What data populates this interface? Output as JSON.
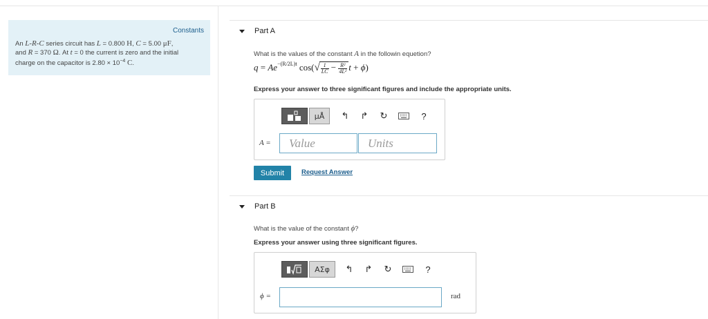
{
  "constants": {
    "title": "Constants",
    "line1_pre": "An ",
    "line1_circuit": "L-R-C",
    "line1_mid": " series circuit has ",
    "line1_L": "L",
    "line1_Lval": " = 0.800 ",
    "line1_Lunit": "H",
    "line1_comma": ", ",
    "line1_C": "C",
    "line1_Cval": " = 5.00 ",
    "line1_Cunit": "μF",
    "line2_pre": "and ",
    "line2_R": "R",
    "line2_Rval": " = 370 ",
    "line2_Runit": "Ω",
    "line2_mid": ". At ",
    "line2_t": "t",
    "line2_rest": " = 0 the current is zero and the initial",
    "line3_pre": "charge on the capacitor is 2.80 × 10",
    "line3_exp": "−4",
    "line3_unit": " C",
    "line3_end": "."
  },
  "partA": {
    "label": "Part A",
    "question_pre": "What is the values of the constant ",
    "question_var": "A",
    "question_post": " in the followin equetion?",
    "eq_q": "q",
    "eq_eq": " = ",
    "eq_A": "Ae",
    "eq_exp": "−(R/2L)t",
    "eq_cos": " cos(",
    "eq_frac1_num": "1",
    "eq_frac1_den": "LC",
    "eq_minus": " − ",
    "eq_frac2_num": "R²",
    "eq_frac2_den": "4L²",
    "eq_t": "t",
    "eq_plus": " + ",
    "eq_phi": "ϕ",
    "eq_close": ")",
    "instruction": "Express your answer to three significant figures and include the appropriate units.",
    "toolbar": {
      "units_btn": "μÅ",
      "help": "?"
    },
    "answer_label": "A =",
    "value_placeholder": "Value",
    "units_placeholder": "Units",
    "submit_label": "Submit",
    "request_label": "Request Answer"
  },
  "partB": {
    "label": "Part B",
    "question_pre": "What is the value of the constant ",
    "question_var": "ϕ",
    "question_post": "?",
    "instruction": "Express your answer using three significant figures.",
    "toolbar": {
      "greek_btn": "ΑΣφ",
      "help": "?"
    },
    "answer_label": "ϕ =",
    "unit": "rad"
  }
}
